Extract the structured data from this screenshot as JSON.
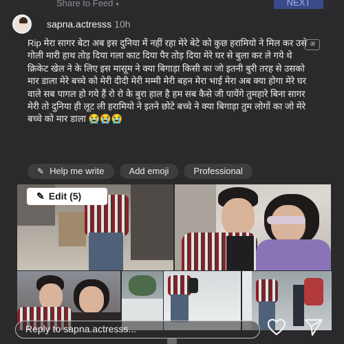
{
  "topbar": {
    "share_label": "Share to Feed",
    "next_label": "NEXT"
  },
  "header": {
    "username": "sapna.actresss",
    "time": "10h"
  },
  "post": {
    "text": "Rip मेरा सागर बेटा अब इस दुनिया में नहीं रहा मेरे बेटे को कुछ हरामियो ने मिल कर उसे गोली मारी हाथ तोड़ दिया गला काट दिया पैर तोड़ दिया मेरे घर से बुला कर ले गये थे क्रिकेट खेल ने के लिए इस मासूम ने क्या बिगाड़ा किसी का जो इतनी बुरी तरह से उसको मार डाला मेरे बच्चे को मेरी दीदी मेरी मम्मी मेरी बहन मेरा भाई मेरा अब क्या होगा मेरे घर वाले सब पागल हो गये हैं रो रो के बुरा हाल है हम सब कैसे जी पायेंगे तुमहारे बिना सागर मेरी तो दुनिया ही लूट ली हरामियो ने इतने छोटे बच्चे ने क्या बिगाड़ा तुम लोगों का जो मेरे बच्चे को मार डाला",
    "emojis": "😭😭😭",
    "translate_glyph": "अ"
  },
  "chips": {
    "help_label": "Help me write",
    "emoji_label": "Add emoji",
    "professional_label": "Professional"
  },
  "media": {
    "edit_label": "Edit (5)"
  },
  "reply": {
    "placeholder": "Reply to sapna.actresss..."
  },
  "colors": {
    "background": "#2a2a2c",
    "accent_next": "#3a4a8a",
    "chip_bg": "#3d3d40"
  }
}
